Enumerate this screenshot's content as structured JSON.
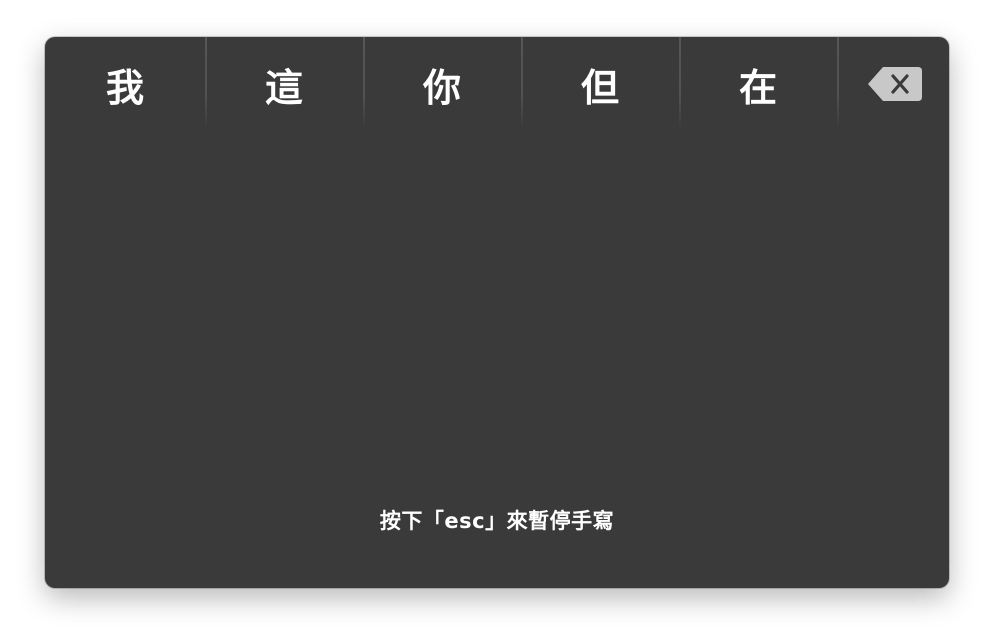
{
  "candidates": [
    {
      "label": "我"
    },
    {
      "label": "這"
    },
    {
      "label": "你"
    },
    {
      "label": "但"
    },
    {
      "label": "在"
    }
  ],
  "delete_button": {
    "icon": "delete-backspace-icon"
  },
  "hint": "按下「esc」來暫停手寫",
  "colors": {
    "panel_bg": "#3a3a3a",
    "text": "#ffffff",
    "delete_icon": "#c8c8c8",
    "divider": "#545454"
  }
}
